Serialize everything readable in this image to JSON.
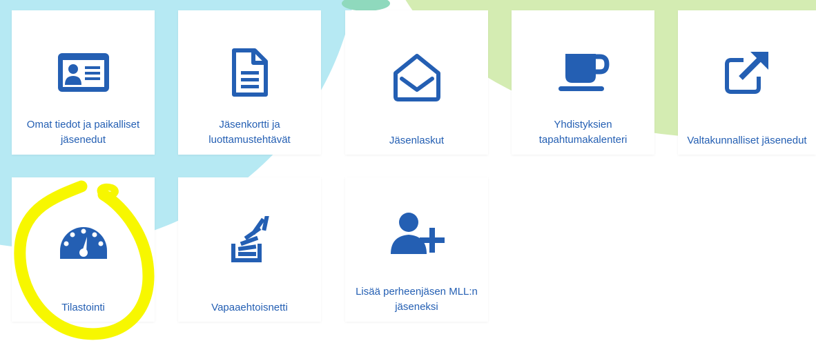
{
  "tiles": [
    {
      "label": "Omat tiedot ja paikalliset jäsenedut",
      "icon": "id-card-icon"
    },
    {
      "label": "Jäsenkortti ja luottamustehtävät",
      "icon": "document-icon"
    },
    {
      "label": "Jäsenlaskut",
      "icon": "envelope-open-icon"
    },
    {
      "label": "Yhdistyksien tapahtumakalenteri",
      "icon": "coffee-cup-icon"
    },
    {
      "label": "Valtakunnalliset jäsenedut",
      "icon": "external-link-icon"
    },
    {
      "label": "Tilastointi",
      "icon": "dashboard-gauge-icon"
    },
    {
      "label": "Vapaaehtoisnetti",
      "icon": "stack-icon"
    },
    {
      "label": "Lisää perheenjäsen MLL:n jäseneksi",
      "icon": "add-user-icon"
    }
  ],
  "colors": {
    "accent": "#245fb3",
    "highlight": "#f7f700",
    "bg_blue": "#b6e9f3",
    "bg_green": "#d4ecb2"
  }
}
